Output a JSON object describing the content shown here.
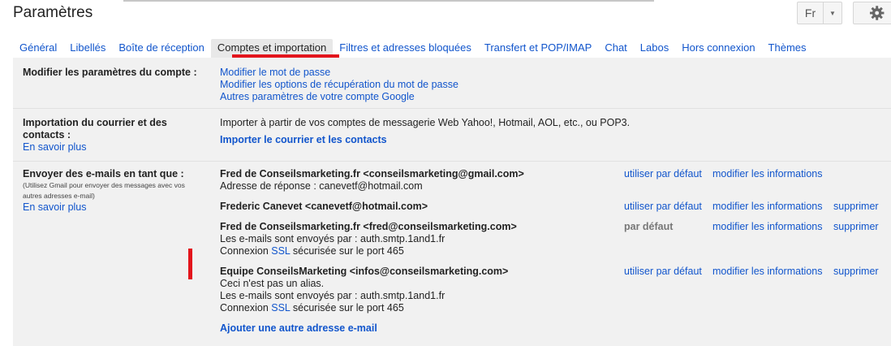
{
  "header": {
    "title": "Paramètres",
    "language": "Fr"
  },
  "tabs": [
    {
      "label": "Général"
    },
    {
      "label": "Libellés"
    },
    {
      "label": "Boîte de réception"
    },
    {
      "label": "Comptes et importation",
      "active": true
    },
    {
      "label": "Filtres et adresses bloquées"
    },
    {
      "label": "Transfert et POP/IMAP"
    },
    {
      "label": "Chat"
    },
    {
      "label": "Labos"
    },
    {
      "label": "Hors connexion"
    },
    {
      "label": "Thèmes"
    }
  ],
  "account": {
    "label": "Modifier les paramètres du compte :",
    "links": [
      "Modifier le mot de passe",
      "Modifier les options de récupération du mot de passe",
      "Autres paramètres de votre compte Google"
    ]
  },
  "import": {
    "label": "Importation du courrier et des contacts :",
    "learn_more": "En savoir plus",
    "description": "Importer à partir de vos comptes de messagerie Web Yahoo!, Hotmail, AOL, etc., ou POP3.",
    "action": "Importer le courrier et les contacts"
  },
  "send_as": {
    "label": "Envoyer des e-mails en tant que :",
    "note": "(Utilisez Gmail pour envoyer des messages avec vos autres adresses e-mail)",
    "learn_more": "En savoir plus",
    "entries": [
      {
        "name": "Fred de Conseilsmarketing.fr <conseilsmarketing@gmail.com>",
        "line1": "Adresse de réponse : canevetf@hotmail.com",
        "default": "utiliser par défaut",
        "modify": "modifier les informations"
      },
      {
        "name": "Frederic Canevet <canevetf@hotmail.com>",
        "default": "utiliser par défaut",
        "modify": "modifier les informations",
        "delete": "supprimer"
      },
      {
        "name": "Fred de Conseilsmarketing.fr <fred@conseilsmarketing.com>",
        "line1": "Les e-mails sont envoyés par : auth.smtp.1and1.fr",
        "ssl_pre": "Connexion ",
        "ssl": "SSL",
        "ssl_post": " sécurisée sur le port 465",
        "default": "par défaut",
        "modify": "modifier les informations",
        "delete": "supprimer"
      },
      {
        "name": "Equipe ConseilsMarketing <infos@conseilsmarketing.com>",
        "line1": "Ceci n'est pas un alias.",
        "line2": "Les e-mails sont envoyés par : auth.smtp.1and1.fr",
        "ssl_pre": "Connexion ",
        "ssl": "SSL",
        "ssl_post": " sécurisée sur le port 465",
        "default": "utiliser par défaut",
        "modify": "modifier les informations",
        "delete": "supprimer"
      }
    ],
    "add_address": "Ajouter une autre adresse e-mail"
  },
  "colors": {
    "link": "#1155cc",
    "marker": "#e3151c",
    "panel": "#f1f1f1"
  }
}
